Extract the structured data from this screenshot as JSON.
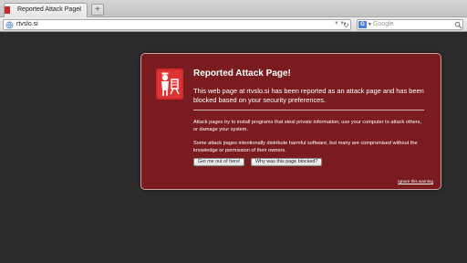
{
  "tab": {
    "title": "Reported Attack Page!",
    "close_glyph": "×"
  },
  "newtab": {
    "glyph": "+"
  },
  "urlbar": {
    "url": "rtvslo.si",
    "arrows_glyph": "▼▼",
    "reload_glyph": "↻"
  },
  "search": {
    "engine_badge": "G",
    "placeholder": "Google",
    "dropdown_glyph": "▼"
  },
  "warning": {
    "title": "Reported Attack Page!",
    "lead": "This web page at rtvslo.si has been reported as an attack page and has been blocked based on your security preferences.",
    "para1": "Attack pages try to install programs that steal private information, use your computer to attack others, or damage your system.",
    "para2": "Some attack pages intentionally distribute harmful software, but many are compromised without the knowledge or permission of their owners.",
    "btn_get_out": "Get me out of here!",
    "btn_why": "Why was this page blocked?",
    "ignore_link": "Ignore this warning"
  },
  "colors": {
    "panel_bg": "#7a1c1f",
    "page_bg": "#2b2b2b",
    "icon_red": "#c52b2b"
  }
}
